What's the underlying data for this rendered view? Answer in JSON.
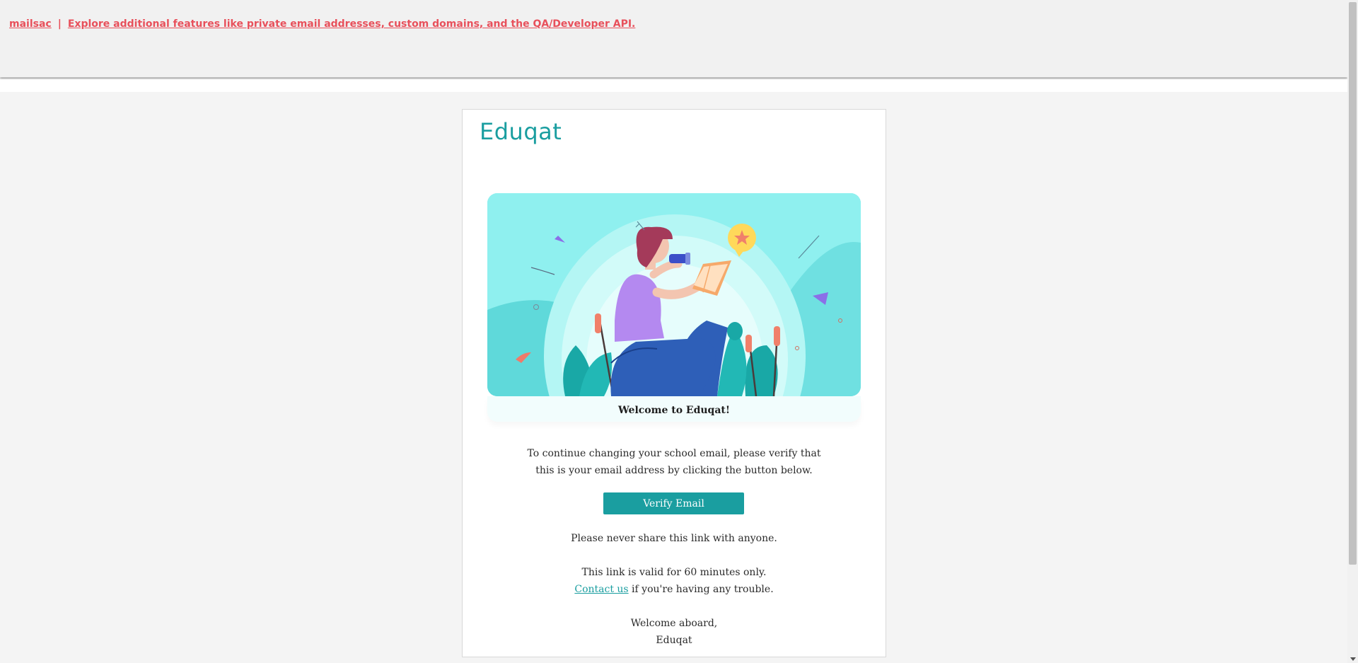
{
  "topbar": {
    "brand_link": "mailsac",
    "separator": "|",
    "promo_link": "Explore additional features like private email addresses, custom domains, and the QA/Developer API."
  },
  "email": {
    "logo_text": "Eduqat",
    "hero_caption": "Welcome to Eduqat!",
    "intro_line1": "To continue changing your school email, please verify that",
    "intro_line2": "this is your email address by clicking the button below.",
    "verify_button": "Verify Email",
    "warning": "Please never share this link with anyone.",
    "validity": "This link is valid for 60 minutes only.",
    "contact_link": "Contact us",
    "contact_suffix": " if you're having any trouble.",
    "signoff_line1": "Welcome aboard,",
    "signoff_line2": "Eduqat"
  },
  "colors": {
    "brand_teal": "#1a9ea0",
    "link_red": "#e8505b",
    "hero_bg": "#8ff0ef"
  }
}
